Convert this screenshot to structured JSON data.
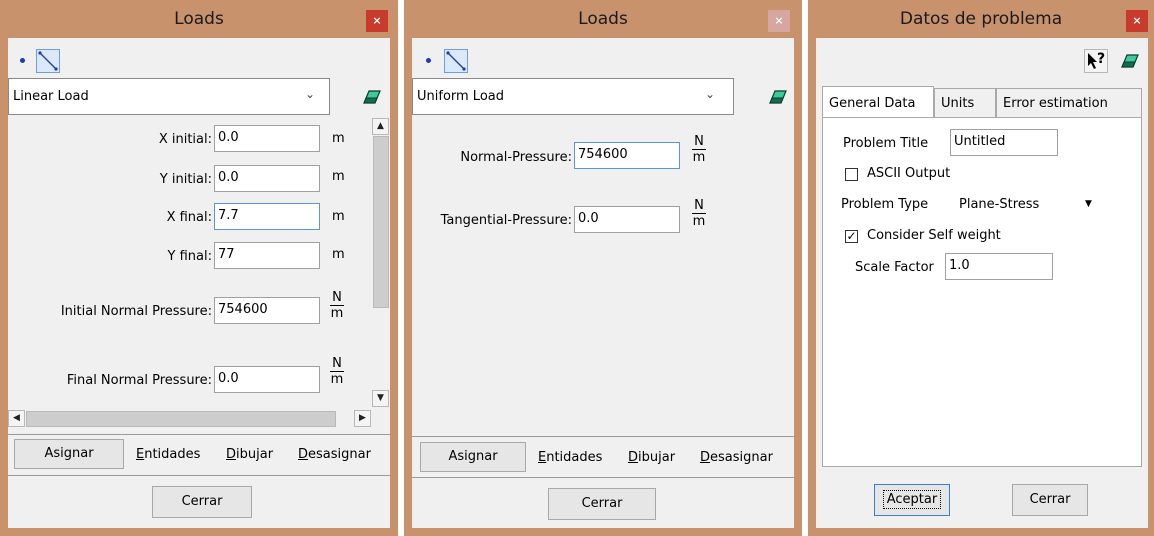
{
  "colors": {
    "frame": "#c8926c",
    "close_button": "#c73a2c",
    "client": "#f0f0f0",
    "focus_border": "#5a95d6"
  },
  "icons": {
    "close": "×",
    "chevron_down": "⌄",
    "scroll_up": "▲",
    "scroll_down": "▼",
    "scroll_left": "◀",
    "scroll_right": "▶",
    "dropdown_arrow": "▼",
    "check": "✓",
    "help": "?"
  },
  "loads_linear": {
    "title": "Loads",
    "load_type": "Linear Load",
    "fields": {
      "x_initial": {
        "label": "X initial:",
        "value": "0.0",
        "unit": "m"
      },
      "y_initial": {
        "label": "Y initial:",
        "value": "0.0",
        "unit": "m"
      },
      "x_final": {
        "label": "X final:",
        "value": "7.7",
        "unit": "m"
      },
      "y_final": {
        "label": "Y final:",
        "value": "77",
        "unit": "m"
      },
      "initial_normal_pressure": {
        "label": "Initial Normal Pressure:",
        "value": "754600",
        "unit_num": "N",
        "unit_den": "m"
      },
      "final_normal_pressure": {
        "label": "Final Normal Pressure:",
        "value": "0.0",
        "unit_num": "N",
        "unit_den": "m"
      }
    },
    "buttons": {
      "assign": "Asignar",
      "entities": "Entidades",
      "draw": "Dibujar",
      "unassign": "Desasignar",
      "close": "Cerrar"
    }
  },
  "loads_uniform": {
    "title": "Loads",
    "load_type": "Uniform Load",
    "fields": {
      "normal_pressure": {
        "label": "Normal-Pressure:",
        "value": "754600",
        "unit_num": "N",
        "unit_den": "m"
      },
      "tangential_pressure": {
        "label": "Tangential-Pressure:",
        "value": "0.0",
        "unit_num": "N",
        "unit_den": "m"
      }
    },
    "buttons": {
      "assign": "Asignar",
      "entities": "Entidades",
      "draw": "Dibujar",
      "unassign": "Desasignar",
      "close": "Cerrar"
    }
  },
  "problem_data": {
    "title": "Datos de problema",
    "tabs": [
      "General Data",
      "Units",
      "Error estimation"
    ],
    "general": {
      "problem_title_label": "Problem Title",
      "problem_title_value": "Untitled",
      "ascii_output_label": "ASCII Output",
      "ascii_output_checked": false,
      "problem_type_label": "Problem Type",
      "problem_type_value": "Plane-Stress",
      "self_weight_label": "Consider Self weight",
      "self_weight_checked": true,
      "scale_factor_label": "Scale Factor",
      "scale_factor_value": "1.0"
    },
    "buttons": {
      "accept": "Aceptar",
      "close": "Cerrar"
    }
  }
}
